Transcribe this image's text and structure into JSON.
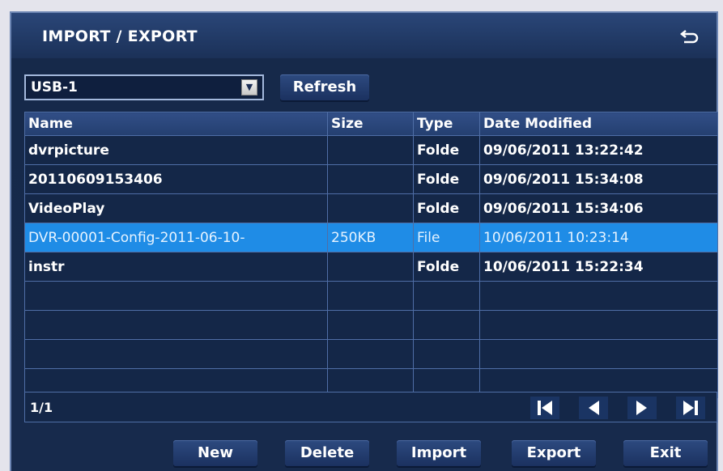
{
  "window": {
    "title": "IMPORT / EXPORT"
  },
  "device": {
    "selected": "USB-1",
    "dropdown_arrow": "▼"
  },
  "toolbar": {
    "refresh_label": "Refresh"
  },
  "table": {
    "columns": [
      "Name",
      "Size",
      "Type",
      "Date Modified"
    ],
    "rows": [
      {
        "name": "dvrpicture",
        "size": "",
        "type": "Folde",
        "date": "09/06/2011 13:22:42"
      },
      {
        "name": "20110609153406",
        "size": "",
        "type": "Folde",
        "date": "09/06/2011 15:34:08"
      },
      {
        "name": "VideoPlay",
        "size": "",
        "type": "Folde",
        "date": "09/06/2011 15:34:06"
      },
      {
        "name": "DVR-00001-Config-2011-06-10-",
        "size": "250KB",
        "type": "File",
        "date": "10/06/2011 10:23:14"
      },
      {
        "name": "instr",
        "size": "",
        "type": "Folde",
        "date": "10/06/2011 15:22:34"
      },
      {
        "name": "",
        "size": "",
        "type": "",
        "date": ""
      },
      {
        "name": "",
        "size": "",
        "type": "",
        "date": ""
      },
      {
        "name": "",
        "size": "",
        "type": "",
        "date": ""
      },
      {
        "name": "",
        "size": "",
        "type": "",
        "date": ""
      }
    ],
    "selected_row": 3
  },
  "pager": {
    "page": "1/1"
  },
  "actions": {
    "new_label": "New",
    "delete_label": "Delete",
    "import_label": "Import",
    "export_label": "Export",
    "exit_label": "Exit"
  },
  "icons": {
    "back": "back-arrow-icon",
    "first": "first-page-icon",
    "prev": "previous-page-icon",
    "next": "next-page-icon",
    "last": "last-page-icon"
  },
  "colors": {
    "background": "#16294a",
    "selected_row": "#1f8ce6",
    "grid": "#4f6ea6"
  }
}
